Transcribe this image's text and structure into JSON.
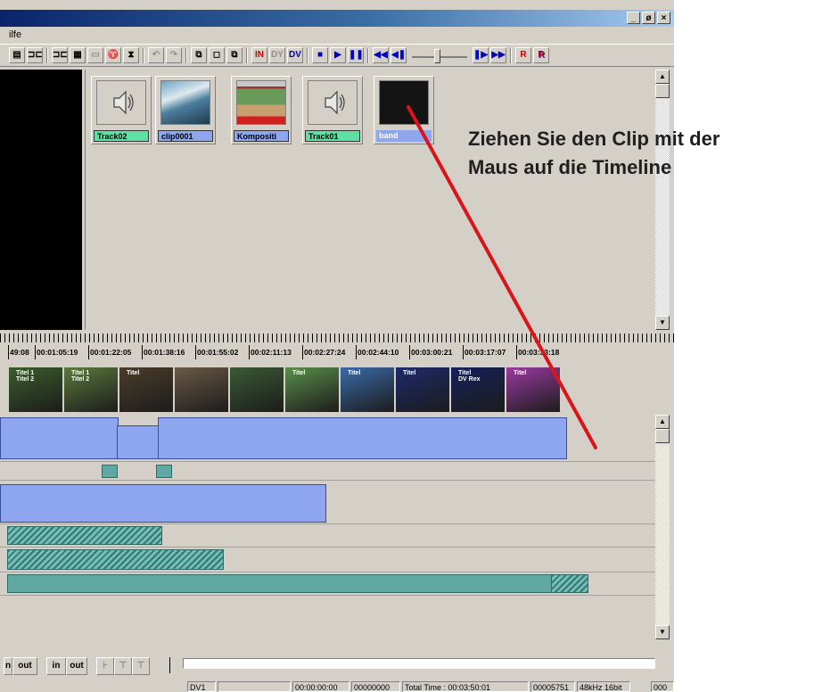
{
  "window": {
    "minimize_label": "_",
    "maximize_label": "ø",
    "close_label": "×"
  },
  "menu": {
    "help_label": "ilfe"
  },
  "toolbar": {
    "in_label": "IN",
    "dy_label": "DY",
    "dv_label": "DV",
    "record_label": "R",
    "record2_label": "R"
  },
  "bin": {
    "clips": [
      {
        "label": "Track02",
        "kind": "audio",
        "icon": "speaker-icon"
      },
      {
        "label": "clip0001",
        "kind": "video",
        "icon": "clip-thumbnail"
      },
      {
        "label": "Kompositi",
        "kind": "video",
        "icon": "clip-thumbnail"
      },
      {
        "label": "Track01",
        "kind": "audio",
        "icon": "speaker-icon"
      },
      {
        "label": "band",
        "kind": "video",
        "icon": "black-thumbnail"
      }
    ]
  },
  "ruler": {
    "timecodes": [
      "49:08",
      "00:01:05:19",
      "00:01:22:05",
      "00:01:38:16",
      "00:01:55:02",
      "00:02:11:13",
      "00:02:27:24",
      "00:02:44:10",
      "00:03:00:21",
      "00:03:17:07",
      "00:03:33:18"
    ]
  },
  "filmstrip": {
    "frames": [
      {
        "text": "Titel 1\nTitel 2",
        "color": "#3b5d2a"
      },
      {
        "text": "Titel 1\nTitel 2",
        "color": "#5b7a3c"
      },
      {
        "text": "Titel",
        "color": "#4a3d2a"
      },
      {
        "text": "",
        "color": "#6a5a44"
      },
      {
        "text": "",
        "color": "#3a5a35"
      },
      {
        "text": "Titel",
        "color": "#5a8f4a"
      },
      {
        "text": "Titel",
        "color": "#3a6aa8"
      },
      {
        "text": "Titel",
        "color": "#1d2a6a"
      },
      {
        "text": "Titel\nDV Rex",
        "color": "#15205a"
      },
      {
        "text": "Titel",
        "color": "#9a3aa0"
      }
    ]
  },
  "bottombar": {
    "in_label": "n",
    "out_label": "out",
    "mark_in_label": "in",
    "mark_out_label": "out"
  },
  "status": {
    "cells": [
      "DV1",
      "",
      "00:00:00:00",
      "00000000",
      "Total Time : 00:03:50:01",
      "00005751",
      "48kHz 16bit",
      "000"
    ]
  },
  "annotation": {
    "line1": "Ziehen Sie den Clip mit der",
    "line2": "Maus auf die Timeline",
    "arrow_color": "#d9141a"
  }
}
